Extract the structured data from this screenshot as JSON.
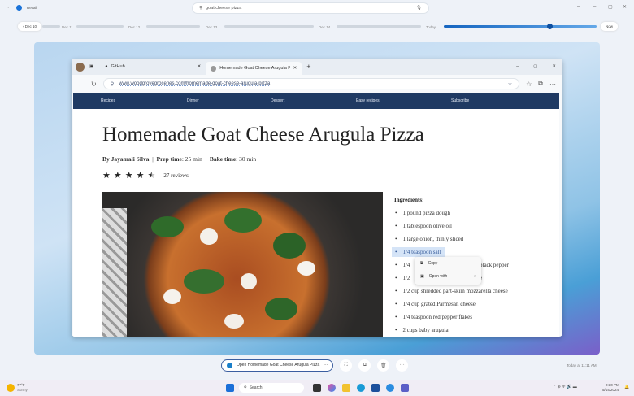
{
  "app": {
    "title": "Recall",
    "back_icon": "arrow-left-icon",
    "search_value": "goat cheese pizza",
    "more": "···"
  },
  "timeline": {
    "labels": [
      "Dec 10",
      "Dec 11",
      "Dec 12",
      "Dec 13",
      "Dec 14",
      "Today"
    ],
    "now": "Now",
    "position_percent": 85
  },
  "browser": {
    "tabs": [
      {
        "label": "GitHub"
      },
      {
        "label": "Homemade Goat Cheese Arugula Pizz"
      }
    ],
    "url": "www.woodgrovegroceries.com/homemade-goat-cheese-arugula-pizza",
    "nav": [
      "Recipes",
      "Dinner",
      "Dessert",
      "Easy recipes",
      "Subscribe"
    ]
  },
  "recipe": {
    "title": "Homemade Goat Cheese Arugula Pizza",
    "by_label": "By Jayamali Silva",
    "prep_label": "Prep time",
    "prep": ": 25 min",
    "bake_label": "Bake time",
    "bake": ": 30 min",
    "rating": 4.5,
    "reviews": "27 reviews",
    "ingredients_heading": "Ingredients:",
    "ingredients": [
      "1 pound pizza dough",
      "1 tablespoon olive oil",
      "1 large onion, thinly sliced",
      "1/4 teaspoon salt",
      "1/4",
      "1/2",
      "1/2 cup shredded part-skim mozzarella cheese",
      "1/4 cup grated Parmesan cheese",
      "1/4 teaspoon red pepper flakes",
      "2 cups baby arugula"
    ],
    "ingredient5_tail": "black pepper",
    "ingredient6_tail": "e"
  },
  "context_menu": {
    "copy": "Copy",
    "open_with": "Open with"
  },
  "bottom": {
    "open_label": "Open Homemade Goat Cheese Arugula Pizza",
    "timestamp": "Today at 11:11 AM"
  },
  "taskbar": {
    "weather_temp": "77°F",
    "weather_desc": "Sunny",
    "search": "Search",
    "time": "2:30 PM",
    "date": "5/14/2024"
  }
}
